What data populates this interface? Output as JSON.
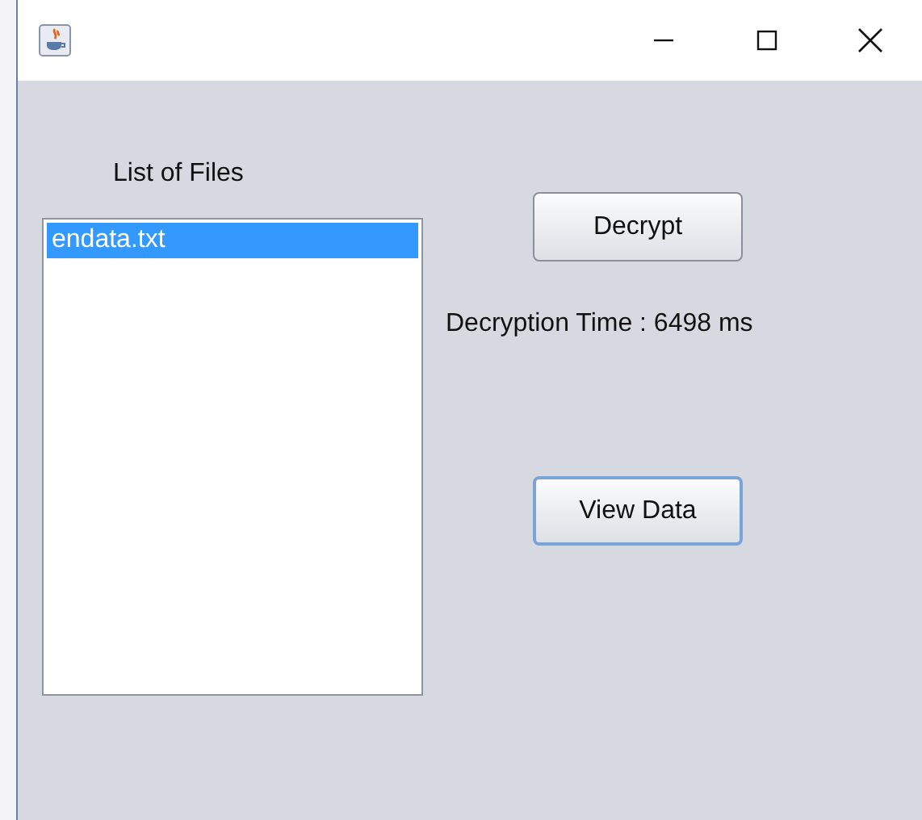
{
  "list_label": "List of Files",
  "files": [
    {
      "name": "endata.txt",
      "selected": true
    }
  ],
  "buttons": [
    {
      "label": "Decrypt",
      "focused": false
    },
    {
      "label": "View Data",
      "focused": true
    }
  ],
  "decryption_time": "Decryption Time : 6498 ms"
}
